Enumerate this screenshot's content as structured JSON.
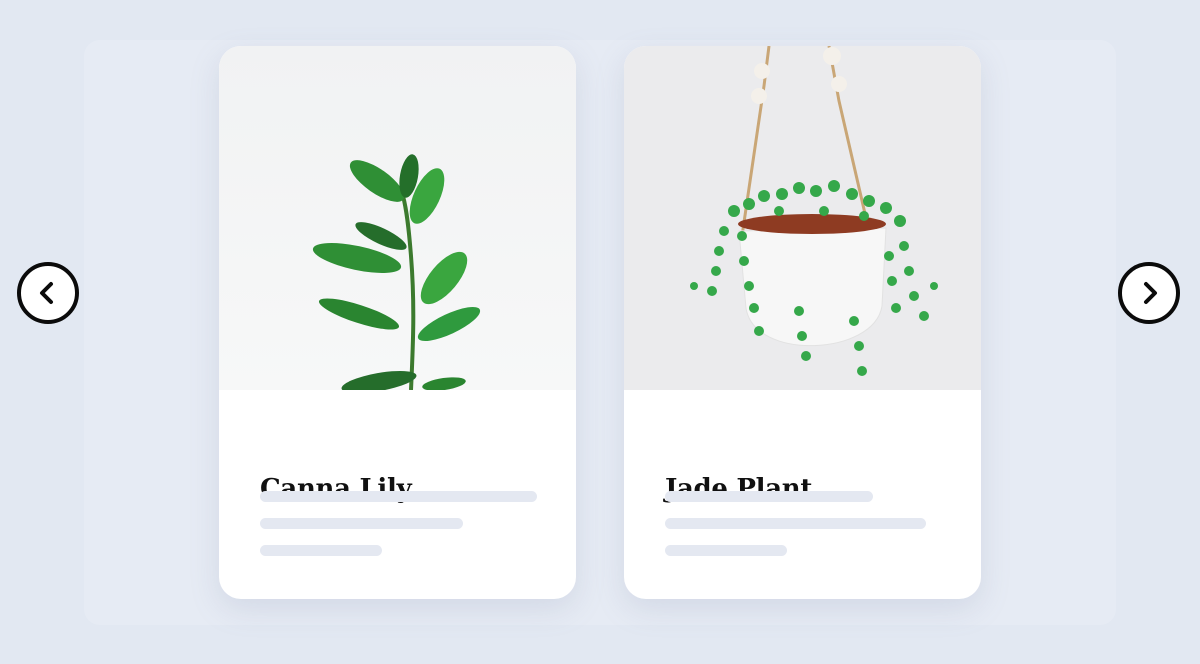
{
  "carousel": {
    "cards": [
      {
        "title": "Canna Lily",
        "image_icon": "ficus-plant-image"
      },
      {
        "title": "Jade Plant",
        "image_icon": "hanging-string-of-pearls-plant-image"
      }
    ],
    "prev_icon": "chevron-left-icon",
    "next_icon": "chevron-right-icon"
  },
  "colors": {
    "background": "#e2e8f2",
    "card": "#ffffff",
    "placeholder_line": "#e4e8f1",
    "leaf_green": "#2f9a3e",
    "nav_border": "#0b0b0b"
  }
}
